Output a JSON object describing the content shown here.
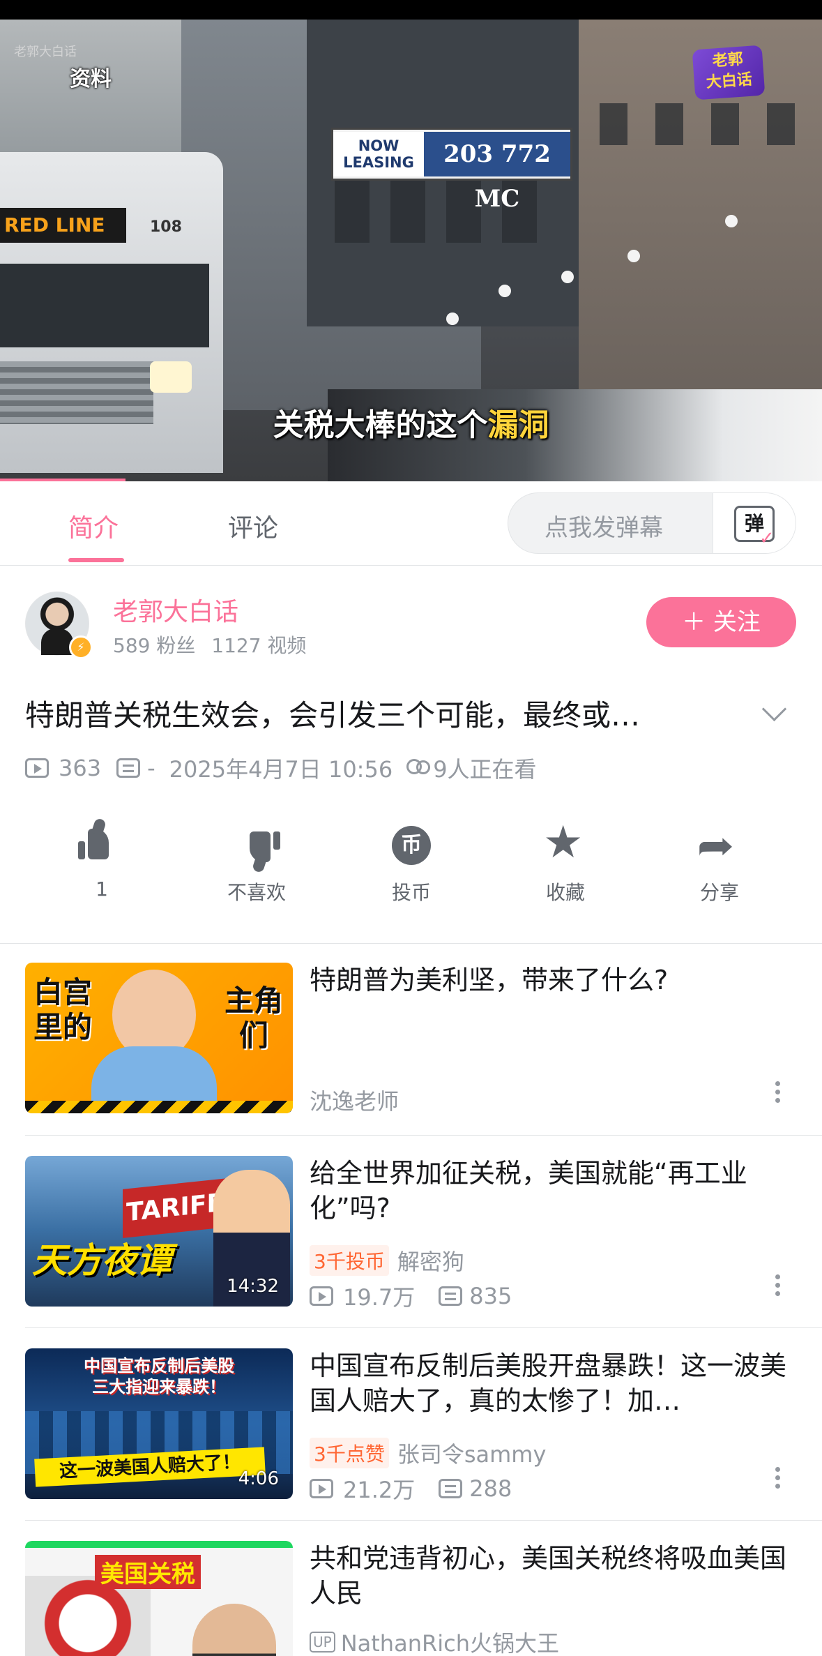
{
  "video": {
    "watermark_tl": "老郭大白话",
    "overlay_label": "资料",
    "channel_logo": "老郭\n大白话",
    "bus_sign": "RED LINE",
    "bus_number": "108",
    "billboard_left": "NOW\nLEASING",
    "billboard_right": "203 772 MC",
    "subtitle_normal": "关税大棒的这个",
    "subtitle_highlight": "漏洞",
    "progress_fraction": 0.153
  },
  "tabs": [
    {
      "label": "简介",
      "active": true
    },
    {
      "label": "评论",
      "active": false
    }
  ],
  "danmaku": {
    "placeholder": "点我发弹幕",
    "button_glyph": "弹"
  },
  "uploader": {
    "name": "老郭大白话",
    "followers": "589 粉丝",
    "videos": "1127 视频",
    "follow_label": "＋ 关注"
  },
  "video_info": {
    "title": "特朗普关税生效会，会引发三个可能，最终或…",
    "plays": "363",
    "danmaku_count": "-",
    "date": "2025年4月7日 10:56",
    "watching": "9人正在看"
  },
  "actions": [
    {
      "name": "like",
      "label": "1",
      "icon": "thumb-up-icon"
    },
    {
      "name": "dislike",
      "label": "不喜欢",
      "icon": "thumb-down-icon"
    },
    {
      "name": "coin",
      "label": "投币",
      "icon": "coin-icon"
    },
    {
      "name": "favorite",
      "label": "收藏",
      "icon": "star-icon"
    },
    {
      "name": "share",
      "label": "分享",
      "icon": "share-icon"
    }
  ],
  "related": [
    {
      "title": "特朗普为美利坚，带来了什么?",
      "author": "沈逸老师",
      "thumb_text_left": "白宫\n里的",
      "thumb_text_right": "主角\n们"
    },
    {
      "title": "给全世界加征关税，美国就能“再工业化”吗?",
      "tag": "3千投币",
      "author": "解密狗",
      "plays": "19.7万",
      "comments": "835",
      "duration": "14:32",
      "thumb_box": "TARIFF",
      "thumb_caption": "天方夜谭"
    },
    {
      "title": "中国宣布反制后美股开盘暴跌！这一波美国人赔大了，真的太惨了！加…",
      "tag": "3千点赞",
      "author": "张司令sammy",
      "plays": "21.2万",
      "comments": "288",
      "duration": "4:06",
      "thumb_title": "中国宣布反制后美股\n三大指迎来暴跌！",
      "thumb_caption": "这一波美国人赔大了！"
    },
    {
      "title": "共和党违背初心，美国关税终将吸血美国人民",
      "up_badge": "UP",
      "author": "NathanRich火锅大王",
      "thumb_title": "美国关税"
    }
  ],
  "colors": {
    "accent": "#fb7299",
    "text": "#18191c",
    "muted": "#9499a0",
    "tag": "#ff6633"
  }
}
